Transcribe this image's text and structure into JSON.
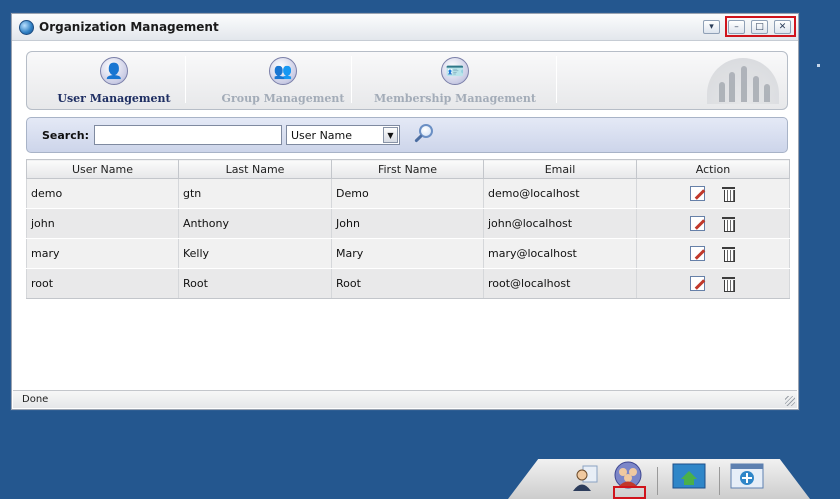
{
  "window": {
    "title": "Organization Management",
    "controls": {
      "menu": "▾",
      "minimize": "–",
      "maximize": "□",
      "close": "✕"
    }
  },
  "tabs": [
    {
      "label": "User Management",
      "icon": "user-icon",
      "active": true
    },
    {
      "label": "Group Management",
      "icon": "group-icon",
      "active": false
    },
    {
      "label": "Membership Management",
      "icon": "membership-icon",
      "active": false
    }
  ],
  "search": {
    "label": "Search:",
    "value": "",
    "placeholder": "",
    "filter_selected": "User Name",
    "filter_arrow": "▼",
    "button_icon": "magnifier-icon"
  },
  "table": {
    "headers": [
      "User Name",
      "Last Name",
      "First Name",
      "Email",
      "Action"
    ],
    "rows": [
      [
        "demo",
        "gtn",
        "Demo",
        "demo@localhost"
      ],
      [
        "john",
        "Anthony",
        "John",
        "john@localhost"
      ],
      [
        "mary",
        "Kelly",
        "Mary",
        "mary@localhost"
      ],
      [
        "root",
        "Root",
        "Root",
        "root@localhost"
      ]
    ],
    "row_actions": [
      "edit-icon",
      "delete-icon"
    ]
  },
  "status": {
    "text": "Done"
  },
  "dock": {
    "items": [
      "user-account-icon",
      "organization-icon",
      "home-page-icon",
      "add-page-icon"
    ],
    "highlight_color": "#d0141c"
  },
  "colors": {
    "desktop": "#24578f",
    "active_tab_text": "#1f2f63",
    "inactive_tab_text": "#a3acb8",
    "highlight": "#d0141c"
  }
}
